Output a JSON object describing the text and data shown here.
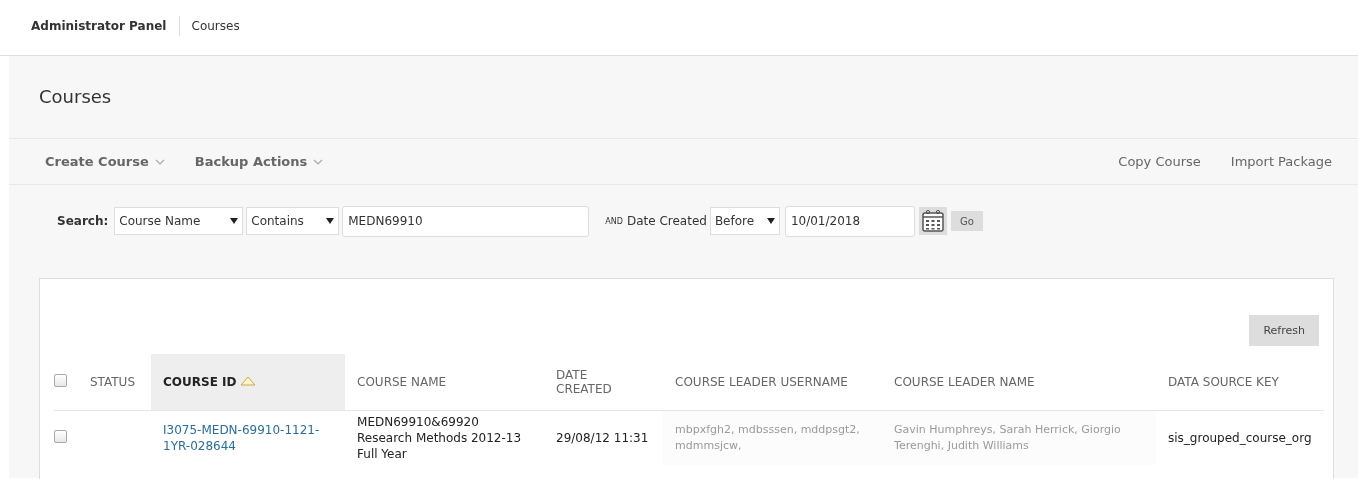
{
  "breadcrumb": [
    {
      "label": "Administrator Panel",
      "current": false
    },
    {
      "label": "Courses",
      "current": true
    }
  ],
  "page_title": "Courses",
  "action_bar": {
    "left": [
      {
        "label": "Create Course"
      },
      {
        "label": "Backup Actions"
      }
    ],
    "right": [
      {
        "label": "Copy Course"
      },
      {
        "label": "Import Package"
      }
    ]
  },
  "search": {
    "label": "Search:",
    "field": "Course Name",
    "operator": "Contains",
    "value": "MEDN69910",
    "and_label": "AND",
    "date_label": "Date Created",
    "date_operator": "Before",
    "date_value": "10/01/2018",
    "go": "Go"
  },
  "refresh": "Refresh",
  "table": {
    "select_all_checked": false,
    "columns": [
      {
        "label": "STATUS",
        "sorted": false
      },
      {
        "label": "COURSE ID",
        "sorted": true
      },
      {
        "label": "COURSE NAME",
        "sorted": false
      },
      {
        "label": "DATE CREATED",
        "sorted": false
      },
      {
        "label": "COURSE LEADER USERNAME",
        "sorted": false
      },
      {
        "label": "COURSE LEADER NAME",
        "sorted": false
      },
      {
        "label": "DATA SOURCE KEY",
        "sorted": false
      }
    ],
    "rows": [
      {
        "checked": false,
        "cells": [
          "",
          "I3075-MEDN-69910-1121-1YR-028644",
          "MEDN69910&69920 Research Methods 2012-13 Full Year",
          "29/08/12 11:31",
          "mbpxfgh2, mdbsssen, mddpsgt2, mdmmsjcw,",
          "Gavin Humphreys, Sarah Herrick, Giorgio Terenghi, Judith Williams",
          "sis_grouped_course_org"
        ]
      }
    ]
  }
}
